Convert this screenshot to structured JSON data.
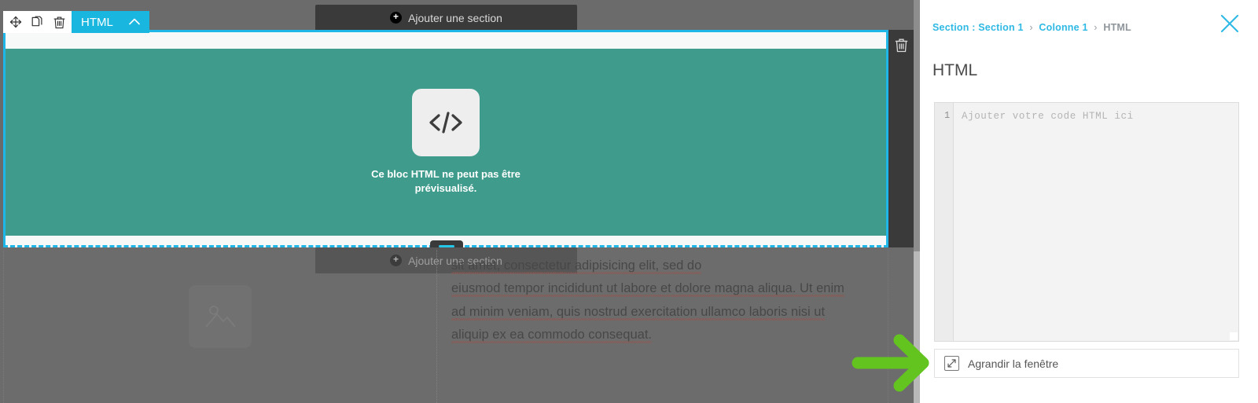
{
  "element_toolbar": {
    "icons": [
      {
        "name": "move-icon",
        "glyph": "move"
      },
      {
        "name": "duplicate-icon",
        "glyph": "copy"
      },
      {
        "name": "delete-icon",
        "glyph": "trash"
      }
    ],
    "tab_label": "HTML",
    "chevron": "⌃"
  },
  "canvas": {
    "add_section_top_label": "Ajouter une section",
    "add_section_bottom_label": "Ajouter une section",
    "plus_glyph": "+",
    "html_block": {
      "icon_name": "code-icon",
      "icon_glyph": "</>",
      "message": "Ce bloc HTML ne peut pas être prévisualisé."
    },
    "section_rail": {
      "delete_icon": "trash-icon"
    },
    "lower_section": {
      "image_placeholder_icon": "image-placeholder-icon",
      "paragraph_visible": "sit amet, consectetur adipisicing elit, sed do eiusmod tempor incididunt ut labore et dolore magna aliqua. Ut enim ad minim veniam, quis nostrud exercitation ullamco laboris nisi ut aliquip ex ea commodo consequat.",
      "lines": [
        "sit amet, consectetur adipisicing elit, sed do",
        "eiusmod tempor incididunt ut labore et dolore magna aliqua. Ut enim",
        "ad minim veniam, quis nostrud exercitation ullamco laboris nisi ut",
        "aliquip ex ea commodo consequat."
      ]
    }
  },
  "panel": {
    "breadcrumb": {
      "section_label": "Section : Section 1",
      "column_label": "Colonne 1",
      "current_label": "HTML",
      "separator": "›"
    },
    "close_icon": "close-icon",
    "title": "HTML",
    "editor": {
      "line_number": "1",
      "placeholder": "Ajouter votre code HTML ici",
      "value": ""
    },
    "expand": {
      "icon_name": "expand-icon",
      "label": "Agrandir la fenêtre"
    }
  },
  "annotation": {
    "arrow_name": "green-arrow-annotation",
    "color": "#63c41f"
  },
  "colors": {
    "accent_cyan": "#19b7e0",
    "block_teal": "#3f9c8d",
    "toolbar_dark": "#3a3a3a",
    "canvas_grey": "#6b6b6b",
    "annotation_green": "#63c41f"
  }
}
